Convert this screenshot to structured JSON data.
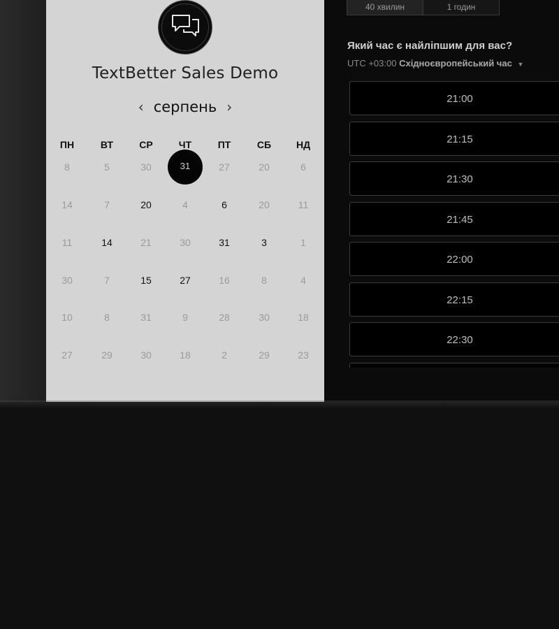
{
  "event": {
    "title": "TextBetter Sales Demo",
    "logo_icon": "chat-bubbles-icon"
  },
  "calendar": {
    "month": "серпень",
    "prev_icon": "chevron-left-icon",
    "next_icon": "chevron-right-icon",
    "weekdays": [
      "ПН",
      "ВТ",
      "СР",
      "ЧТ",
      "ПТ",
      "СБ",
      "НД"
    ],
    "weeks": [
      [
        {
          "label": "8",
          "state": "muted"
        },
        {
          "label": "5",
          "state": "muted"
        },
        {
          "label": "30",
          "state": "muted"
        },
        {
          "label": "31",
          "state": "selected"
        },
        {
          "label": "27",
          "state": "muted"
        },
        {
          "label": "20",
          "state": "muted"
        },
        {
          "label": "6",
          "state": "muted"
        }
      ],
      [
        {
          "label": "14",
          "state": "muted"
        },
        {
          "label": "7",
          "state": "muted"
        },
        {
          "label": "20",
          "state": "available"
        },
        {
          "label": "4",
          "state": "muted"
        },
        {
          "label": "6",
          "state": "available"
        },
        {
          "label": "20",
          "state": "muted"
        },
        {
          "label": "11",
          "state": "muted"
        }
      ],
      [
        {
          "label": "11",
          "state": "muted"
        },
        {
          "label": "14",
          "state": "available"
        },
        {
          "label": "21",
          "state": "muted"
        },
        {
          "label": "30",
          "state": "muted"
        },
        {
          "label": "31",
          "state": "available"
        },
        {
          "label": "3",
          "state": "available"
        },
        {
          "label": "1",
          "state": "muted"
        }
      ],
      [
        {
          "label": "30",
          "state": "muted"
        },
        {
          "label": "7",
          "state": "muted"
        },
        {
          "label": "15",
          "state": "available"
        },
        {
          "label": "27",
          "state": "available"
        },
        {
          "label": "16",
          "state": "muted"
        },
        {
          "label": "8",
          "state": "muted"
        },
        {
          "label": "4",
          "state": "muted"
        }
      ],
      [
        {
          "label": "10",
          "state": "muted"
        },
        {
          "label": "8",
          "state": "muted"
        },
        {
          "label": "31",
          "state": "muted"
        },
        {
          "label": "9",
          "state": "muted"
        },
        {
          "label": "28",
          "state": "muted"
        },
        {
          "label": "30",
          "state": "muted"
        },
        {
          "label": "18",
          "state": "muted"
        }
      ],
      [
        {
          "label": "27",
          "state": "muted"
        },
        {
          "label": "29",
          "state": "muted"
        },
        {
          "label": "30",
          "state": "muted"
        },
        {
          "label": "18",
          "state": "muted"
        },
        {
          "label": "2",
          "state": "muted"
        },
        {
          "label": "29",
          "state": "muted"
        },
        {
          "label": "23",
          "state": "muted"
        }
      ]
    ]
  },
  "duration": {
    "options": [
      "40 хвилин",
      "1 годин"
    ],
    "selected": "40 хвилин"
  },
  "scheduling": {
    "question": "Який час є найліпшим для вас?",
    "timezone_offset": "UTC +03:00",
    "timezone_name": "Східноєвропейський час",
    "timezone_caret_icon": "caret-down-icon",
    "time_slots": [
      "21:00",
      "21:15",
      "21:30",
      "21:45",
      "22:00",
      "22:15",
      "22:30",
      ""
    ]
  },
  "colors": {
    "calendar_bg": "#d4d4d4",
    "right_bg": "#0b0b0b",
    "selected_day_bg": "#050505"
  }
}
